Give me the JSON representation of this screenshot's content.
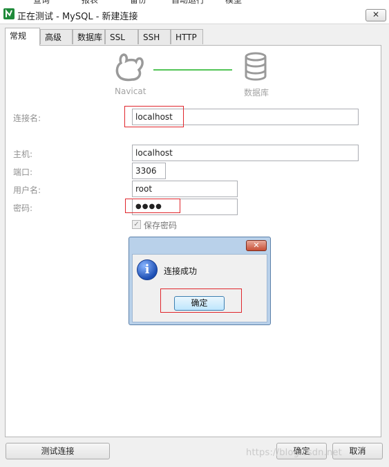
{
  "menu": {
    "items": [
      "查询",
      "报表",
      "备份",
      "自动运行",
      "模型"
    ]
  },
  "window": {
    "title": "正在测试 - MySQL - 新建连接",
    "close_glyph": "✕"
  },
  "tabs": [
    {
      "label": "常规",
      "active": true
    },
    {
      "label": "高级"
    },
    {
      "label": "数据库"
    },
    {
      "label": "SSL"
    },
    {
      "label": "SSH"
    },
    {
      "label": "HTTP"
    }
  ],
  "diagram": {
    "left_caption": "Navicat",
    "right_caption": "数据库",
    "line_color": "#52c456"
  },
  "form": {
    "conn_name_label": "连接名:",
    "conn_name_value": "localhost",
    "host_label": "主机:",
    "host_value": "localhost",
    "port_label": "端口:",
    "port_value": "3306",
    "user_label": "用户名:",
    "user_value": "root",
    "password_label": "密码:",
    "password_value": "●●●●",
    "save_password_label": "保存密码",
    "save_password_checked": true
  },
  "dialog": {
    "close_glyph": "✕",
    "icon_glyph": "i",
    "message": "连接成功",
    "ok_label": "确定"
  },
  "footer": {
    "test_label": "测试连接",
    "ok_label": "确定",
    "cancel_label": "取消"
  },
  "watermark": "https://blog.csdn.net",
  "colors": {
    "highlight_box": "#e0252b"
  }
}
